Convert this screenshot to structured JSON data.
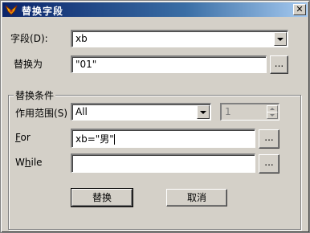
{
  "window": {
    "title": "替换字段",
    "close_symbol": "✕"
  },
  "field": {
    "label": "字段",
    "hotkey": "(D):",
    "value": "xb"
  },
  "replace": {
    "label": "替换为",
    "value": "\"01\"",
    "builder_button": "..."
  },
  "conditions": {
    "group_title": "替换条件",
    "scope": {
      "label": "作用范围",
      "hotkey": "(S)",
      "value": "All",
      "count_value": "1"
    },
    "for": {
      "label_hotkey": "F",
      "label_rest": "or",
      "value": "xb=\"男\"",
      "builder_button": "..."
    },
    "while": {
      "label_pre": "W",
      "label_hotkey": "h",
      "label_rest": "ile",
      "value": "",
      "builder_button": "..."
    }
  },
  "buttons": {
    "ok": "替换",
    "cancel": "取消"
  }
}
